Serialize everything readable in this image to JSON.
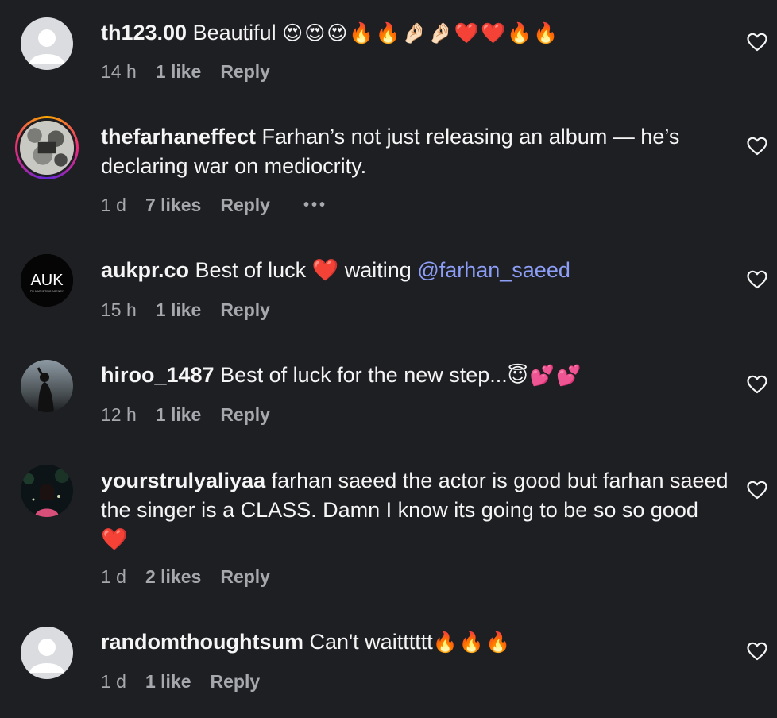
{
  "comments": [
    {
      "username": "th123.00",
      "text": " Beautiful ",
      "emoji": "😍😍😍🔥🔥🤌🏻🤌🏻❤️❤️🔥🔥",
      "time": "14 h",
      "likes": "1 like",
      "reply": "Reply",
      "avatar": "default-avatar"
    },
    {
      "username": "thefarhaneffect",
      "text": " Farhan’s not just releasing an album — he’s declaring war on mediocrity.",
      "time": "1 d",
      "likes": "7 likes",
      "reply": "Reply",
      "more": "•••",
      "avatar": "story-ring-avatar"
    },
    {
      "username": "aukpr.co",
      "text_before": " Best of luck ",
      "heart": "❤️",
      "text_after": " waiting ",
      "mention": "@farhan_saeed",
      "time": "15 h",
      "likes": "1 like",
      "reply": "Reply",
      "avatar_label": "AUK",
      "avatar_sub": "PR MARKETING AGENCY"
    },
    {
      "username": "hiroo_1487",
      "text": " Best of luck for the new step...",
      "emoji": "😇💕💕",
      "time": "12 h",
      "likes": "1 like",
      "reply": "Reply",
      "avatar": "photo-avatar"
    },
    {
      "username": "yourstrulyaliyaa",
      "text": " farhan saeed the actor is good but farhan saeed the singer is a CLASS. Damn I know its going to be so so good ",
      "heart": "❤️",
      "time": "1 d",
      "likes": "2 likes",
      "reply": "Reply",
      "avatar": "photo-avatar"
    },
    {
      "username": "randomthoughtsum",
      "text": " Can't waitttttt",
      "emoji": "🔥🔥🔥",
      "time": "1 d",
      "likes": "1 like",
      "reply": "Reply",
      "avatar": "default-avatar"
    }
  ],
  "colors": {
    "background": "#1e1f23",
    "text": "#f5f5f5",
    "meta": "#a7a8ad",
    "mention": "#8c9ef6"
  }
}
